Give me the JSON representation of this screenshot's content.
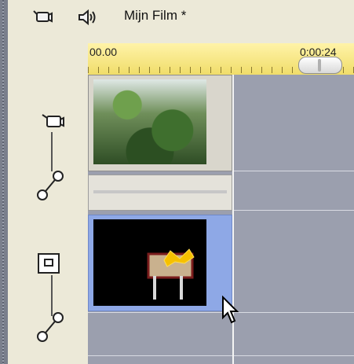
{
  "header": {
    "title": "Mijn Film *",
    "icons": [
      "video-camera-icon",
      "speaker-icon"
    ]
  },
  "ruler": {
    "start_time": "00.00",
    "end_time": "0:00:24"
  },
  "controls": {
    "icons": [
      "video-camera-icon",
      "volume-link-icon",
      "title-box-icon",
      "volume-link-icon"
    ]
  },
  "tracks": [
    {
      "type": "video",
      "clip": "video-clip"
    },
    {
      "type": "audio",
      "clip": "audio-clip"
    },
    {
      "type": "title",
      "clip": "title-clip"
    }
  ]
}
